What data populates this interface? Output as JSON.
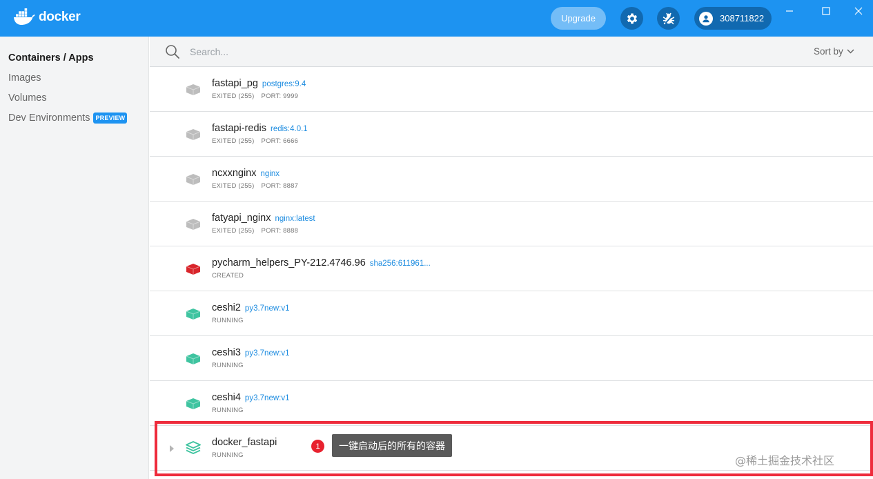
{
  "titlebar": {
    "brand": "docker",
    "upgrade_label": "Upgrade",
    "account_label": "308711822",
    "settings_icon": "gear-icon",
    "troubleshoot_icon": "bug-icon",
    "brand_color": "#1d93f1"
  },
  "sidebar": {
    "items": [
      {
        "label": "Containers / Apps",
        "active": true
      },
      {
        "label": "Images"
      },
      {
        "label": "Volumes"
      },
      {
        "label": "Dev Environments",
        "badge": "PREVIEW"
      }
    ]
  },
  "search": {
    "placeholder": "Search...",
    "value": "",
    "sort_label": "Sort by"
  },
  "containers": [
    {
      "name": "fastapi_pg",
      "image": "postgres:9.4",
      "status": "EXITED (255)",
      "port": "PORT: 9999",
      "state": "exited"
    },
    {
      "name": "fastapi-redis",
      "image": "redis:4.0.1",
      "status": "EXITED (255)",
      "port": "PORT: 6666",
      "state": "exited"
    },
    {
      "name": "ncxxnginx",
      "image": "nginx",
      "status": "EXITED (255)",
      "port": "PORT: 8887",
      "state": "exited"
    },
    {
      "name": "fatyapi_nginx",
      "image": "nginx:latest",
      "status": "EXITED (255)",
      "port": "PORT: 8888",
      "state": "exited"
    },
    {
      "name": "pycharm_helpers_PY-212.4746.96",
      "image": "sha256:611961...",
      "status": "CREATED",
      "port": "",
      "state": "created"
    },
    {
      "name": "ceshi2",
      "image": "py3.7new:v1",
      "status": "RUNNING",
      "port": "",
      "state": "running"
    },
    {
      "name": "ceshi3",
      "image": "py3.7new:v1",
      "status": "RUNNING",
      "port": "",
      "state": "running"
    },
    {
      "name": "ceshi4",
      "image": "py3.7new:v1",
      "status": "RUNNING",
      "port": "",
      "state": "running"
    },
    {
      "name": "docker_fastapi",
      "image": "",
      "status": "RUNNING",
      "port": "",
      "state": "app"
    }
  ],
  "annotation": {
    "number": "1",
    "text": "一键启动后的所有的容器"
  },
  "watermark": "@稀土掘金技术社区",
  "colors": {
    "exited": "#bdbdbd",
    "created": "#d9252b",
    "running": "#3fc4a0",
    "highlight": "#ee2c3c"
  }
}
